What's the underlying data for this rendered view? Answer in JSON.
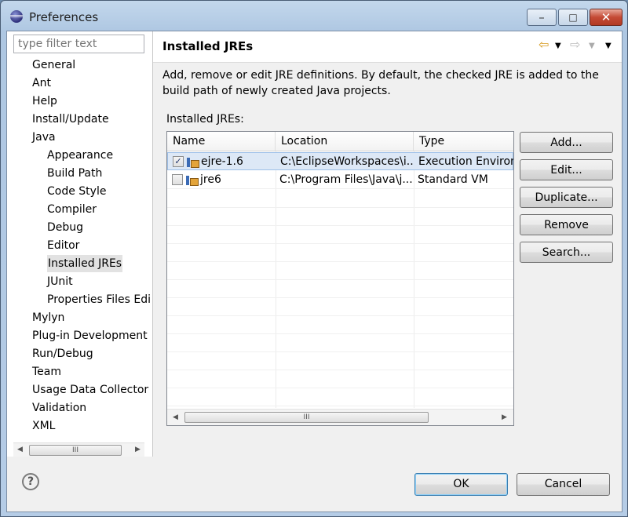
{
  "window": {
    "title": "Preferences",
    "minimize": "▭",
    "maximize": "▢",
    "close": "✕"
  },
  "filter": {
    "placeholder": "type filter text"
  },
  "tree": [
    {
      "label": "General",
      "level": 0
    },
    {
      "label": "Ant",
      "level": 0
    },
    {
      "label": "Help",
      "level": 0
    },
    {
      "label": "Install/Update",
      "level": 0
    },
    {
      "label": "Java",
      "level": 0
    },
    {
      "label": "Appearance",
      "level": 1
    },
    {
      "label": "Build Path",
      "level": 1
    },
    {
      "label": "Code Style",
      "level": 1
    },
    {
      "label": "Compiler",
      "level": 1
    },
    {
      "label": "Debug",
      "level": 1
    },
    {
      "label": "Editor",
      "level": 1
    },
    {
      "label": "Installed JREs",
      "level": 1,
      "selected": true
    },
    {
      "label": "JUnit",
      "level": 1
    },
    {
      "label": "Properties Files Edi",
      "level": 1
    },
    {
      "label": "Mylyn",
      "level": 0
    },
    {
      "label": "Plug-in Development",
      "level": 0
    },
    {
      "label": "Run/Debug",
      "level": 0
    },
    {
      "label": "Team",
      "level": 0
    },
    {
      "label": "Usage Data Collector",
      "level": 0
    },
    {
      "label": "Validation",
      "level": 0
    },
    {
      "label": "XML",
      "level": 0
    }
  ],
  "page": {
    "title": "Installed JREs",
    "description": "Add, remove or edit JRE definitions. By default, the checked JRE is added to the build path of newly created Java projects.",
    "list_label": "Installed JREs:",
    "list_label_mnemonic": "J",
    "columns": [
      "Name",
      "Location",
      "Type"
    ],
    "rows": [
      {
        "name": "ejre-1.6",
        "location": "C:\\EclipseWorkspaces\\i...",
        "type": "Execution Environi",
        "checked": true
      },
      {
        "name": "jre6",
        "location": "C:\\Program Files\\Java\\j...",
        "type": "Standard VM",
        "checked": false
      }
    ]
  },
  "buttons": {
    "add": "Add...",
    "edit": "Edit...",
    "duplicate": "Duplicate...",
    "remove": "Remove",
    "search": "Search...",
    "ok": "OK",
    "cancel": "Cancel"
  },
  "icons": {
    "back": "back-arrow-icon",
    "forward": "forward-arrow-icon",
    "menu": "view-menu-icon",
    "help": "help-icon"
  },
  "glyphs": {
    "scroll_left": "◀",
    "scroll_right": "▶",
    "grip": "III",
    "help": "?",
    "check": "✓"
  }
}
